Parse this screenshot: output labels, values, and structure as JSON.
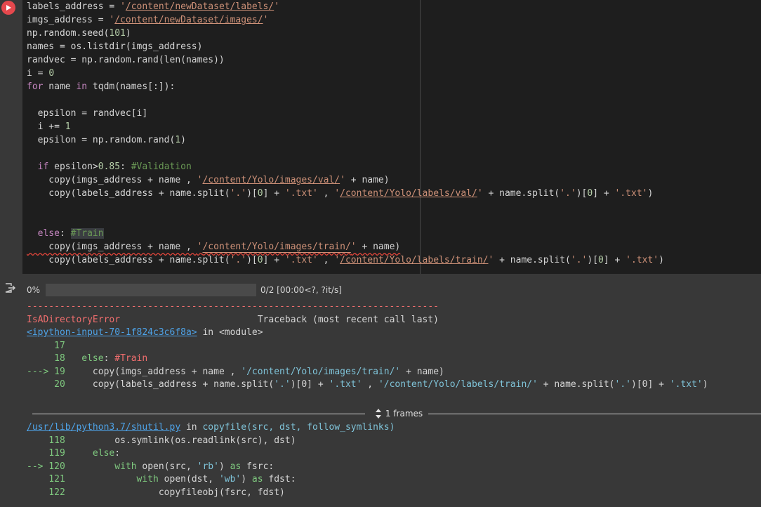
{
  "cell": {
    "code_lines": [
      [
        {
          "t": "labels_address = "
        },
        {
          "t": "'",
          "c": "str"
        },
        {
          "t": "/content/newDataset/labels/",
          "c": "strlink"
        },
        {
          "t": "'",
          "c": "str"
        }
      ],
      [
        {
          "t": "imgs_address = "
        },
        {
          "t": "'",
          "c": "str"
        },
        {
          "t": "/content/newDataset/images/",
          "c": "strlink"
        },
        {
          "t": "'",
          "c": "str"
        }
      ],
      [
        {
          "t": "np.random.seed("
        },
        {
          "t": "101",
          "c": "num"
        },
        {
          "t": ")"
        }
      ],
      [
        {
          "t": "names = os.listdir(imgs_address)"
        }
      ],
      [
        {
          "t": "randvec = np.random.rand(len(names))"
        }
      ],
      [
        {
          "t": "i = "
        },
        {
          "t": "0",
          "c": "num"
        }
      ],
      [
        {
          "t": "for",
          "c": "kw"
        },
        {
          "t": " name "
        },
        {
          "t": "in",
          "c": "kw"
        },
        {
          "t": " tqdm(names[:]):"
        }
      ],
      [
        {
          "t": ""
        }
      ],
      [
        {
          "t": "  epsilon = randvec[i]"
        }
      ],
      [
        {
          "t": "  i += "
        },
        {
          "t": "1",
          "c": "num"
        }
      ],
      [
        {
          "t": "  epsilon = np.random.rand("
        },
        {
          "t": "1",
          "c": "num"
        },
        {
          "t": ")"
        }
      ],
      [
        {
          "t": ""
        }
      ],
      [
        {
          "t": "  "
        },
        {
          "t": "if",
          "c": "kw"
        },
        {
          "t": " epsilon>"
        },
        {
          "t": "0.85",
          "c": "num"
        },
        {
          "t": ": "
        },
        {
          "t": "#Validation",
          "c": "cmt"
        }
      ],
      [
        {
          "t": "    copy(imgs_address + name , "
        },
        {
          "t": "'",
          "c": "str"
        },
        {
          "t": "/content/Yolo/images/val/",
          "c": "strlink"
        },
        {
          "t": "'",
          "c": "str"
        },
        {
          "t": " + name)"
        }
      ],
      [
        {
          "t": "    copy(labels_address + name.split("
        },
        {
          "t": "'.'",
          "c": "str"
        },
        {
          "t": ")["
        },
        {
          "t": "0",
          "c": "num"
        },
        {
          "t": "] + "
        },
        {
          "t": "'.txt'",
          "c": "str"
        },
        {
          "t": " , "
        },
        {
          "t": "'",
          "c": "str"
        },
        {
          "t": "/content/Yolo/labels/val/",
          "c": "strlink"
        },
        {
          "t": "'",
          "c": "str"
        },
        {
          "t": " + name.split("
        },
        {
          "t": "'.'",
          "c": "str"
        },
        {
          "t": ")["
        },
        {
          "t": "0",
          "c": "num"
        },
        {
          "t": "] + "
        },
        {
          "t": "'.txt'",
          "c": "str"
        },
        {
          "t": ")"
        }
      ],
      [
        {
          "t": ""
        }
      ],
      [
        {
          "t": ""
        }
      ],
      [
        {
          "t": "  "
        },
        {
          "t": "else",
          "c": "kw"
        },
        {
          "t": ": "
        },
        {
          "t": "#Train",
          "c": "cmt hl"
        }
      ],
      [
        {
          "t": "    copy(imgs_address + name , "
        },
        {
          "t": "'",
          "c": "str"
        },
        {
          "t": "/content/Yolo/images/train/",
          "c": "strlink"
        },
        {
          "t": "'",
          "c": "str"
        },
        {
          "t": " + name)",
          "sq": true
        }
      ],
      [
        {
          "t": "    copy(labels_address + name.split("
        },
        {
          "t": "'.'",
          "c": "str"
        },
        {
          "t": ")["
        },
        {
          "t": "0",
          "c": "num"
        },
        {
          "t": "] + "
        },
        {
          "t": "'.txt'",
          "c": "str"
        },
        {
          "t": " , "
        },
        {
          "t": "'",
          "c": "str"
        },
        {
          "t": "/content/Yolo/labels/train/",
          "c": "strlink"
        },
        {
          "t": "'",
          "c": "str"
        },
        {
          "t": " + name.split("
        },
        {
          "t": "'.'",
          "c": "str"
        },
        {
          "t": ")["
        },
        {
          "t": "0",
          "c": "num"
        },
        {
          "t": "] + "
        },
        {
          "t": "'.txt'",
          "c": "str"
        },
        {
          "t": ")"
        }
      ]
    ]
  },
  "output": {
    "progress": {
      "percent_label": "0%",
      "fraction": 0,
      "status": "0/2 [00:00<?, ?it/s]"
    },
    "traceback_lines": [
      [
        {
          "t": "---------------------------------------------------------------------------",
          "c": "red"
        }
      ],
      [
        {
          "t": "IsADirectoryError",
          "c": "red"
        },
        {
          "t": "                         Traceback (most recent call last)"
        }
      ],
      [
        {
          "t": "<ipython-input-70-1f824c3c6f8a>",
          "c": "link"
        },
        {
          "t": " in "
        },
        {
          "t": "<module>"
        }
      ],
      [
        {
          "t": "     17",
          "c": "green"
        }
      ],
      [
        {
          "t": "     18 ",
          "c": "green"
        },
        {
          "t": "  else",
          "c": "green"
        },
        {
          "t": ": "
        },
        {
          "t": "#Train",
          "c": "red"
        }
      ],
      [
        {
          "t": "---> 19 ",
          "c": "green"
        },
        {
          "t": "    copy(imgs_address + name , "
        },
        {
          "t": "'/content/Yolo/images/train/'",
          "c": "cyan"
        },
        {
          "t": " + name)"
        }
      ],
      [
        {
          "t": "     20 ",
          "c": "green"
        },
        {
          "t": "    copy(labels_address + name.split("
        },
        {
          "t": "'.'",
          "c": "cyan"
        },
        {
          "t": ")[0] + "
        },
        {
          "t": "'.txt'",
          "c": "cyan"
        },
        {
          "t": " , "
        },
        {
          "t": "'/content/Yolo/labels/train/'",
          "c": "cyan"
        },
        {
          "t": " + name.split("
        },
        {
          "t": "'.'",
          "c": "cyan"
        },
        {
          "t": ")[0] + "
        },
        {
          "t": "'.txt'",
          "c": "cyan"
        },
        {
          "t": ")"
        }
      ]
    ],
    "frames_label": "1 frames",
    "traceback2_lines": [
      [
        {
          "t": "/usr/lib/python3.7/shutil.py",
          "c": "link"
        },
        {
          "t": " in "
        },
        {
          "t": "copyfile(src, dst, follow_symlinks)",
          "c": "cyan"
        }
      ],
      [
        {
          "t": "    118 ",
          "c": "green"
        },
        {
          "t": "        os.symlink(os.readlink(src), dst)"
        }
      ],
      [
        {
          "t": "    119 ",
          "c": "green"
        },
        {
          "t": "    else",
          "c": "green"
        },
        {
          "t": ":"
        }
      ],
      [
        {
          "t": "--> 120 ",
          "c": "green"
        },
        {
          "t": "        "
        },
        {
          "t": "with",
          "c": "green"
        },
        {
          "t": " open(src, "
        },
        {
          "t": "'rb'",
          "c": "cyan"
        },
        {
          "t": ") "
        },
        {
          "t": "as",
          "c": "green"
        },
        {
          "t": " fsrc:"
        }
      ],
      [
        {
          "t": "    121 ",
          "c": "green"
        },
        {
          "t": "            "
        },
        {
          "t": "with",
          "c": "green"
        },
        {
          "t": " open(dst, "
        },
        {
          "t": "'wb'",
          "c": "cyan"
        },
        {
          "t": ") "
        },
        {
          "t": "as",
          "c": "green"
        },
        {
          "t": " fdst:"
        }
      ],
      [
        {
          "t": "    122 ",
          "c": "green"
        },
        {
          "t": "                copyfileobj(fsrc, fdst)"
        }
      ]
    ]
  }
}
